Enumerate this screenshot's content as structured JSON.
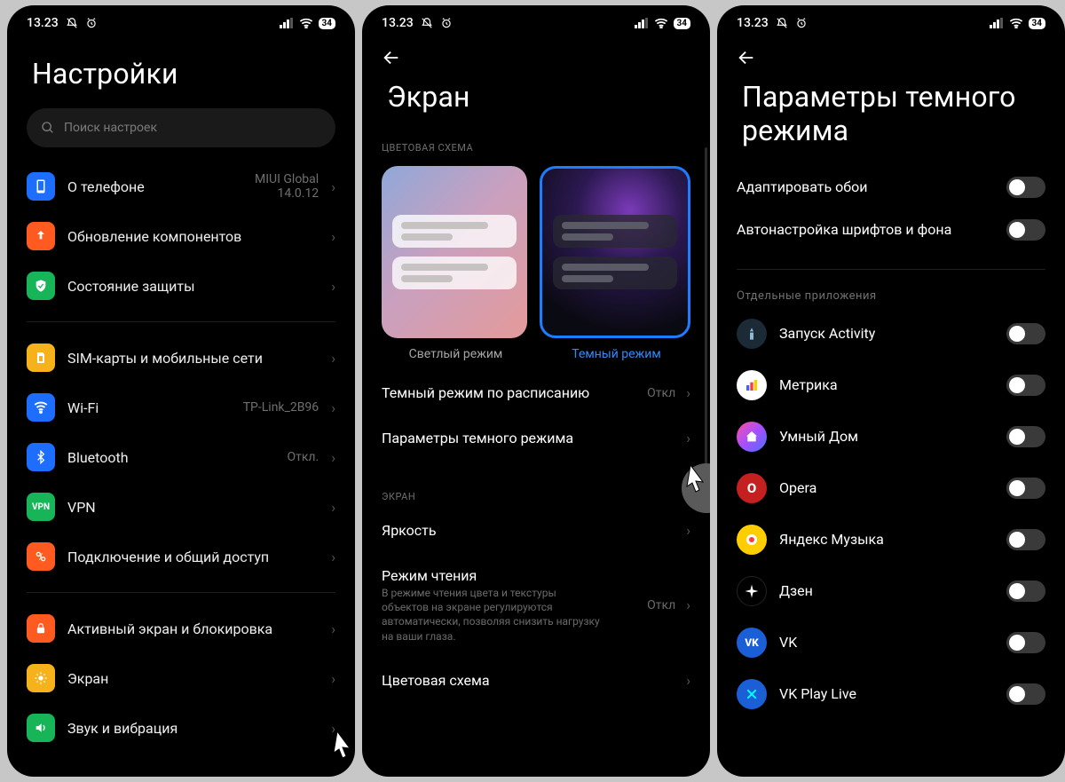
{
  "statusbar": {
    "time": "13.23",
    "battery": "34"
  },
  "screen1": {
    "title": "Настройки",
    "search_placeholder": "Поиск настроек",
    "group1": [
      {
        "icon_bg": "#1d6dff",
        "glyph": "▭",
        "label": "О телефоне",
        "value": "MIUI Global\n14.0.12"
      },
      {
        "icon_bg": "#ff5a1f",
        "glyph": "⬆",
        "label": "Обновление компонентов",
        "value": ""
      },
      {
        "icon_bg": "#17b558",
        "glyph": "✔",
        "label": "Состояние защиты",
        "value": ""
      }
    ],
    "group2": [
      {
        "icon_bg": "#f6b21a",
        "glyph": "▮",
        "label": "SIM-карты и мобильные сети",
        "value": ""
      },
      {
        "icon_bg": "#1d6dff",
        "glyph": "wifi",
        "label": "Wi-Fi",
        "value": "TP-Link_2B96"
      },
      {
        "icon_bg": "#1d6dff",
        "glyph": "bt",
        "label": "Bluetooth",
        "value": "Откл."
      },
      {
        "icon_bg": "#17b558",
        "glyph": "VPN",
        "label": "VPN",
        "value": ""
      },
      {
        "icon_bg": "#ff5a1f",
        "glyph": "⟳",
        "label": "Подключение и общий доступ",
        "value": ""
      }
    ],
    "group3": [
      {
        "icon_bg": "#ff5a1f",
        "glyph": "🔒",
        "label": "Активный экран и блокировка",
        "value": ""
      },
      {
        "icon_bg": "#f6b21a",
        "glyph": "☀",
        "label": "Экран",
        "value": ""
      },
      {
        "icon_bg": "#17b558",
        "glyph": "🔊",
        "label": "Звук и вибрация",
        "value": ""
      }
    ]
  },
  "screen2": {
    "title": "Экран",
    "section_color": "ЦВЕТОВАЯ СХЕМА",
    "light_label": "Светлый режим",
    "dark_label": "Темный режим",
    "rows_a": [
      {
        "label": "Темный режим по расписанию",
        "value": "Откл"
      },
      {
        "label": "Параметры темного режима",
        "value": ""
      }
    ],
    "section_screen": "ЭКРАН",
    "brightness": {
      "label": "Яркость",
      "value": ""
    },
    "reading": {
      "label": "Режим чтения",
      "desc": "В режиме чтения цвета и текстуры объектов на экране регулируются автоматически, позволяя снизить нагрузку на ваши глаза.",
      "value": "Откл"
    },
    "color_scheme": {
      "label": "Цветовая схема",
      "value": ""
    }
  },
  "screen3": {
    "title": "Параметры темного режима",
    "top_toggles": [
      {
        "label": "Адаптировать обои"
      },
      {
        "label": "Автонастройка шрифтов и фона"
      }
    ],
    "section_apps": "Отдельные приложения",
    "apps": [
      {
        "bg": "#1c2a36",
        "glyph": "🚀",
        "label": "Запуск Activity"
      },
      {
        "bg": "#ffffff",
        "glyph": "bars",
        "label": "Метрика"
      },
      {
        "bg": "grad-home",
        "glyph": "⬠",
        "label": "Умный Дом"
      },
      {
        "bg": "#c4201f",
        "glyph": "O",
        "label": "Opera"
      },
      {
        "bg": "#ffce00",
        "glyph": "ym",
        "label": "Яндекс Музыка"
      },
      {
        "bg": "#000000",
        "glyph": "✦",
        "label": "Дзен"
      },
      {
        "bg": "#1a5fd6",
        "glyph": "VK",
        "label": "VK"
      },
      {
        "bg": "#1a5fd6",
        "glyph": "✖",
        "label": "VK Play Live"
      }
    ]
  }
}
